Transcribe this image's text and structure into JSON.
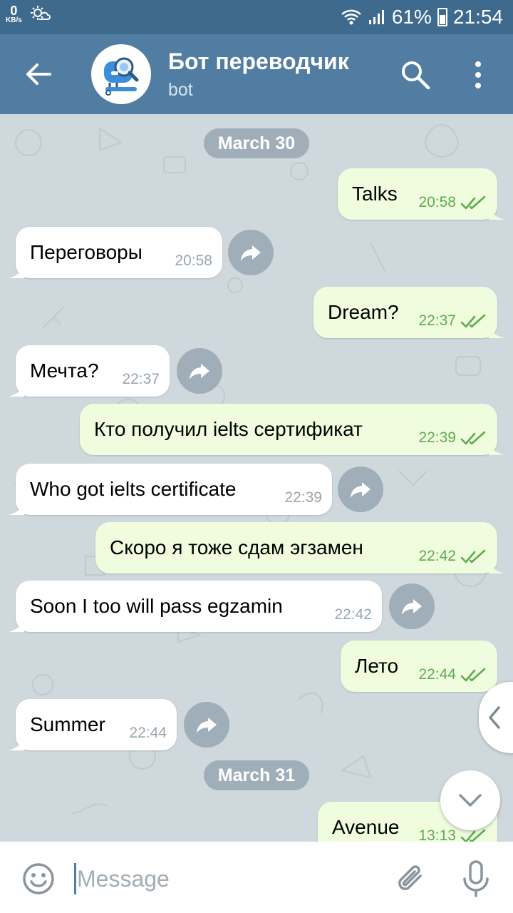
{
  "status_bar": {
    "kbs_value": "0",
    "kbs_unit": "KB/s",
    "battery": "61%",
    "time": "21:54"
  },
  "header": {
    "title": "Бот переводчик",
    "subtitle": "bot",
    "icons": [
      "back-arrow-icon",
      "search-icon",
      "more-vert-icon"
    ]
  },
  "colors": {
    "header": "#527da3",
    "status_bar": "#3e6a8d",
    "outgoing_bubble": "#effdde",
    "incoming_bubble": "#ffffff",
    "outgoing_time": "#5fab4f"
  },
  "dates": [
    "March 30",
    "March 31"
  ],
  "messages": [
    {
      "dir": "out",
      "text": "Talks",
      "time": "20:58"
    },
    {
      "dir": "in",
      "text": "Переговоры",
      "time": "20:58"
    },
    {
      "dir": "out",
      "text": "Dream?",
      "time": "22:37"
    },
    {
      "dir": "in",
      "text": "Мечта?",
      "time": "22:37"
    },
    {
      "dir": "out",
      "text": "Кто получил ielts сертификат",
      "time": "22:39"
    },
    {
      "dir": "in",
      "text": "Who got ielts certificate",
      "time": "22:39"
    },
    {
      "dir": "out",
      "text": "Скоро я тоже сдам эгзамен",
      "time": "22:42"
    },
    {
      "dir": "in",
      "text": "Soon I too will pass egzamin",
      "time": "22:42"
    },
    {
      "dir": "out",
      "text": "Лето",
      "time": "22:44"
    },
    {
      "dir": "in",
      "text": "Summer",
      "time": "22:44"
    },
    {
      "dir": "out",
      "text": "Avenue",
      "time": "13:13"
    }
  ],
  "input": {
    "placeholder": "Message"
  }
}
